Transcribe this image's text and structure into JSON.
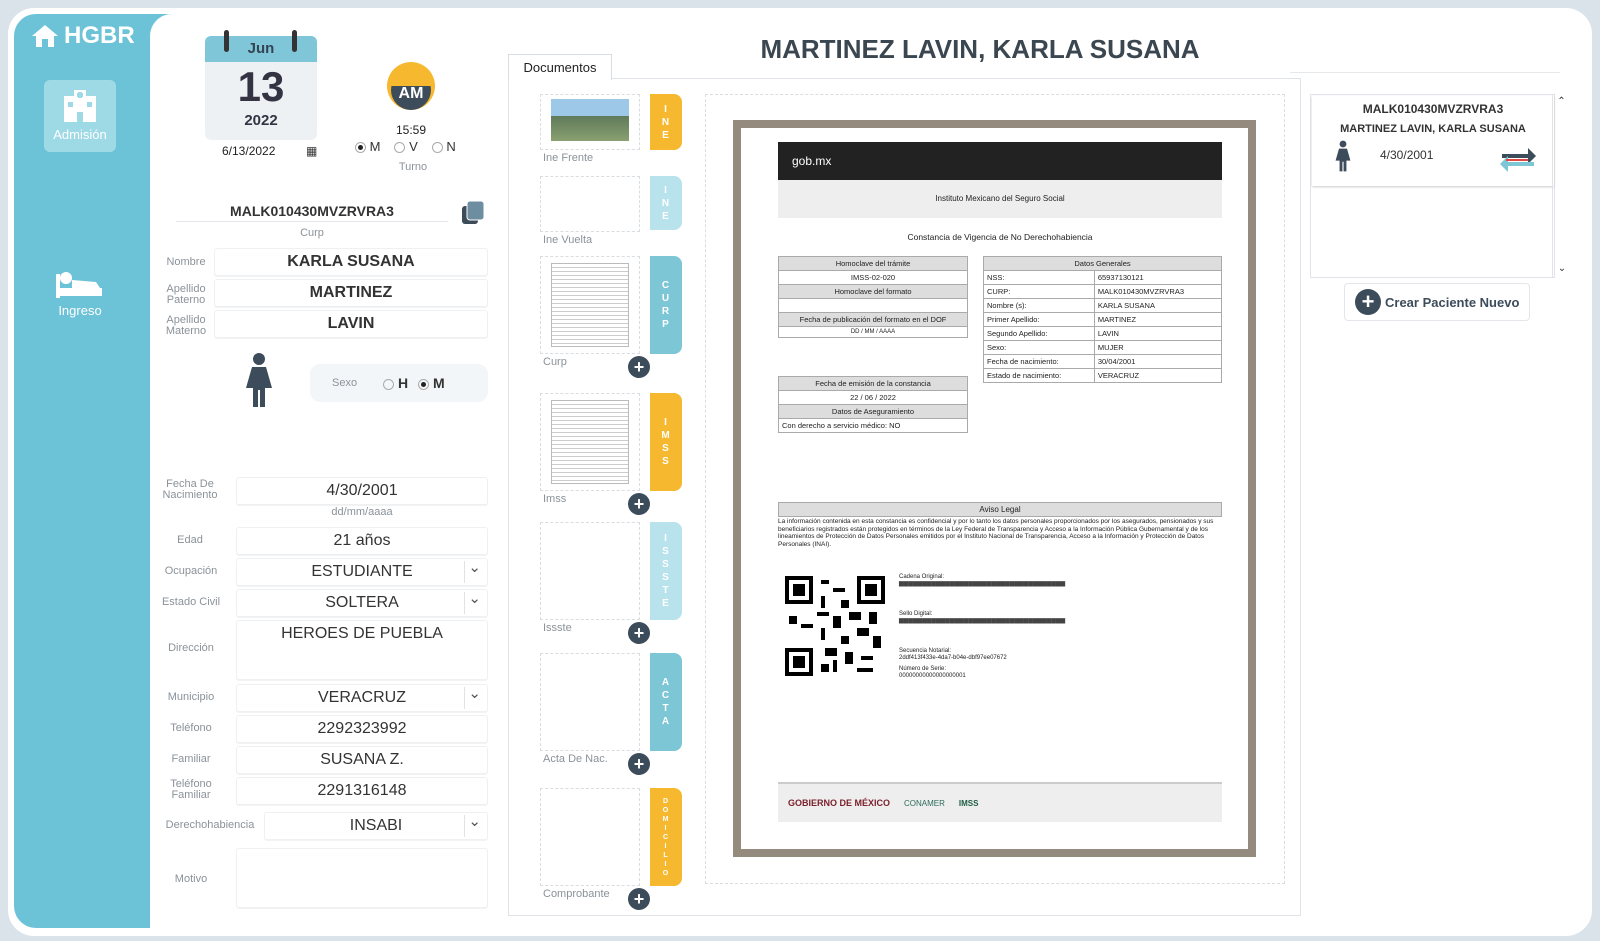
{
  "app": {
    "name": "HGBR"
  },
  "nav": {
    "admision": "Admisión",
    "ingreso": "Ingreso"
  },
  "calendar": {
    "month": "Jun",
    "day": "13",
    "year": "2022",
    "date": "6/13/2022"
  },
  "turno": {
    "ampm": "AM",
    "time": "15:59",
    "options": [
      "M",
      "V",
      "N"
    ],
    "selected": "M",
    "label": "Turno"
  },
  "patient": {
    "curp": "MALK010430MVZRVRA3",
    "curp_label": "Curp",
    "nombre_label": "Nombre",
    "nombre": "KARLA SUSANA",
    "apellido_paterno_label": "Apellido Paterno",
    "apellido_paterno": "MARTINEZ",
    "apellido_materno_label": "Apellido Materno",
    "apellido_materno": "LAVIN",
    "sexo_label": "Sexo",
    "sexo_options": [
      "H",
      "M"
    ],
    "sexo_selected": "M",
    "fecha_nac_label": "Fecha De Nacimiento",
    "fecha_nac": "4/30/2001",
    "fecha_format": "dd/mm/aaaa",
    "edad_label": "Edad",
    "edad": "21 años",
    "ocupacion_label": "Ocupación",
    "ocupacion": "ESTUDIANTE",
    "estado_civil_label": "Estado Civil",
    "estado_civil": "SOLTERA",
    "direccion_label": "Dirección",
    "direccion": "HEROES DE PUEBLA",
    "municipio_label": "Municipio",
    "municipio": "VERACRUZ",
    "telefono_label": "Teléfono",
    "telefono": "2292323992",
    "familiar_label": "Familiar",
    "familiar": "SUSANA Z.",
    "telefono_familiar_label": "Teléfono Familiar",
    "telefono_familiar": "2291316148",
    "derecho_label": "Derechohabiencia",
    "derecho": "INSABI",
    "motivo_label": "Motivo",
    "motivo": ""
  },
  "header": {
    "title": "MARTINEZ LAVIN, KARLA SUSANA"
  },
  "documents": {
    "tab": "Documentos",
    "items": [
      {
        "label": "Ine Frente",
        "badge": "INE",
        "color": "orange",
        "plus": false
      },
      {
        "label": "Ine Vuelta",
        "badge": "INE",
        "color": "lteal",
        "plus": false
      },
      {
        "label": "Curp",
        "badge": "CURP",
        "color": "teal",
        "plus": true
      },
      {
        "label": "Imss",
        "badge": "IMSS",
        "color": "orange",
        "plus": true
      },
      {
        "label": "Issste",
        "badge": "ISSSTE",
        "color": "lteal",
        "plus": true
      },
      {
        "label": "Acta De Nac.",
        "badge": "ACTA",
        "color": "teal",
        "plus": true
      },
      {
        "label": "Comprobante",
        "badge": "DOMICILIO",
        "color": "orange",
        "plus": true
      }
    ]
  },
  "doc_preview": {
    "gob": "gob.mx",
    "institute": "Instituto Mexicano del Seguro Social",
    "heading": "Constancia de Vigencia de No Derechohabiencia",
    "homoclave_tramite_label": "Homoclave del trámite",
    "homoclave_tramite": "IMSS-02-020",
    "homoclave_formato_label": "Homoclave del formato",
    "fecha_pub_label": "Fecha de publicación del formato en el DOF",
    "fecha_format": "DD / MM / AAAA",
    "fecha_emision_label": "Fecha de emisión de la constancia",
    "fecha_emision": "22 / 06 / 2022",
    "datos_aseg_label": "Datos de Aseguramiento",
    "derecho_servicio": "Con derecho a servicio médico: NO",
    "datos_generales_label": "Datos Generales",
    "nss_label": "NSS:",
    "nss": "65937130121",
    "curp_label": "CURP:",
    "curp": "MALK010430MVZRVRA3",
    "nombre_label": "Nombre (s):",
    "nombre": "KARLA SUSANA",
    "primer_ap_label": "Primer Apellido:",
    "primer_ap": "MARTINEZ",
    "segundo_ap_label": "Segundo Apellido:",
    "segundo_ap": "LAVIN",
    "sexo_label": "Sexo:",
    "sexo": "MUJER",
    "fecha_nac_label": "Fecha de nacimiento:",
    "fecha_nac": "30/04/2001",
    "estado_nac_label": "Estado de nacimiento:",
    "estado_nac": "VERACRUZ",
    "aviso_label": "Aviso Legal",
    "aviso": "La información contenida en esta constancia es confidencial y por lo tanto los datos personales proporcionados por los asegurados, pensionados y sus beneficiarios registrados están protegidos en términos de la Ley Federal de Transparencia y Acceso a la Información Pública Gubernamental y de los lineamientos de Protección de Datos Personales emitidos por el Instituto Nacional de Transparencia, Acceso a la Información y Protección de Datos Personales (INAI).",
    "cadena_label": "Cadena Original:",
    "sello_label": "Sello Digital:",
    "secuencia_label": "Secuencia Notarial:",
    "secuencia": "2ddf413f433e-4da7-b04e-dbf97ee07672",
    "serie_label": "Número de Serie:",
    "serie": "00000000000000000001",
    "footer_gob": "GOBIERNO DE MÉXICO",
    "footer_conamer": "CONAMER",
    "footer_imss": "IMSS"
  },
  "right_panel": {
    "curp": "MALK010430MVZRVRA3",
    "name": "MARTINEZ LAVIN, KARLA SUSANA",
    "dob": "4/30/2001",
    "new_button": "Crear Paciente Nuevo"
  }
}
